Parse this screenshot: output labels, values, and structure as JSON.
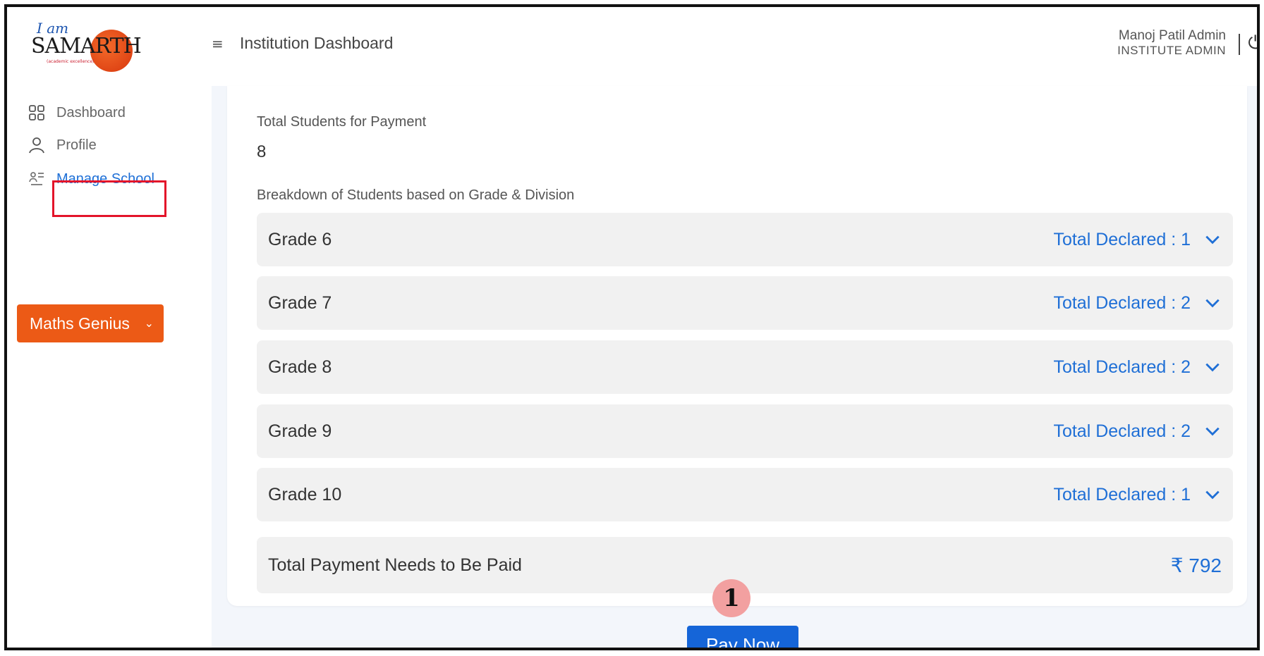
{
  "header": {
    "logo": {
      "prefix": "I am",
      "word": "SAMARTH",
      "tagline": "(academic excellence)"
    },
    "title": "Institution Dashboard",
    "user_name": "Manoj Patil Admin",
    "user_role": "INSTITUTE ADMIN"
  },
  "sidebar": {
    "items": [
      {
        "label": "Dashboard",
        "icon": "grid-icon"
      },
      {
        "label": "Profile",
        "icon": "user-icon"
      },
      {
        "label": "Manage School",
        "icon": "school-icon",
        "active": true
      }
    ],
    "program": {
      "label": "Maths Genius"
    }
  },
  "main": {
    "total_students_label": "Total Students for Payment",
    "total_students_value": "8",
    "breakdown_label": "Breakdown of Students based on Grade & Division",
    "grades": [
      {
        "label": "Grade 6",
        "declared": "Total Declared : 1"
      },
      {
        "label": "Grade 7",
        "declared": "Total Declared : 2"
      },
      {
        "label": "Grade 8",
        "declared": "Total Declared : 2"
      },
      {
        "label": "Grade 9",
        "declared": "Total Declared : 2"
      },
      {
        "label": "Grade 10",
        "declared": "Total Declared : 1"
      }
    ],
    "total_payment_label": "Total Payment Needs to Be Paid",
    "total_payment_value": "₹ 792"
  },
  "annotation": {
    "step": "1"
  },
  "actions": {
    "pay_now": "Pay Now"
  },
  "colors": {
    "accent": "#1f6fd6",
    "brand_orange": "#ec5a16",
    "highlight": "#e3142a",
    "pay_button": "#1565d8"
  }
}
